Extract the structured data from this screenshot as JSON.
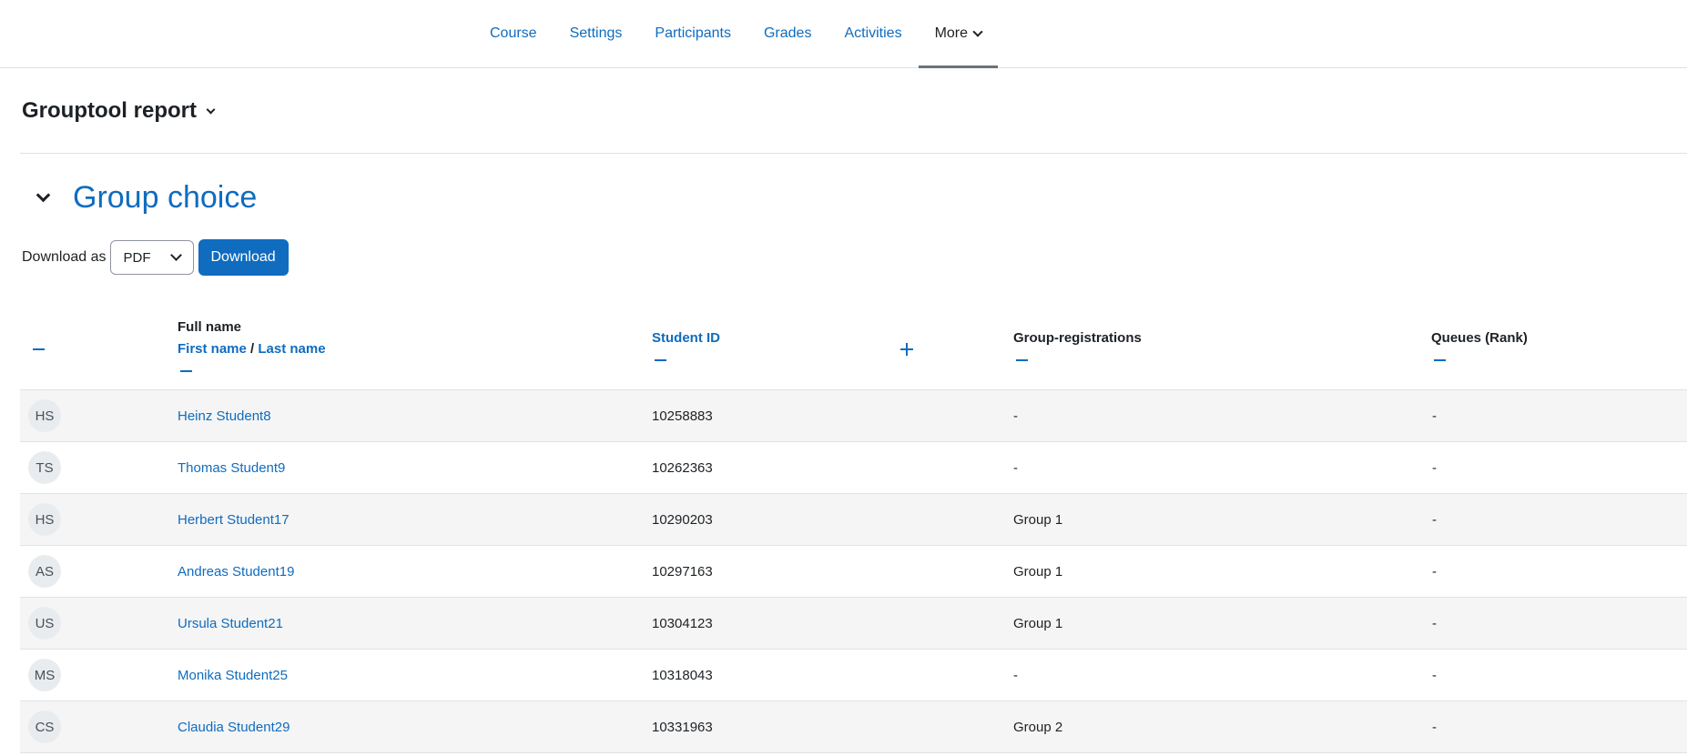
{
  "nav": {
    "items": [
      {
        "label": "Course"
      },
      {
        "label": "Settings"
      },
      {
        "label": "Participants"
      },
      {
        "label": "Grades"
      },
      {
        "label": "Activities"
      },
      {
        "label": "More"
      }
    ],
    "active_index": 5
  },
  "page": {
    "title": "Grouptool report"
  },
  "section": {
    "title": "Group choice"
  },
  "download": {
    "label": "Download as",
    "format_selected": "PDF",
    "button_label": "Download"
  },
  "table": {
    "headers": {
      "full_name": "Full name",
      "first_name": "First name",
      "separator": "/",
      "last_name": "Last name",
      "student_id": "Student ID",
      "group_registrations": "Group-registrations",
      "queues_rank": "Queues (Rank)"
    },
    "rows": [
      {
        "initials": "HS",
        "name": "Heinz Student8",
        "student_id": "10258883",
        "group": "-",
        "queue": "-"
      },
      {
        "initials": "TS",
        "name": "Thomas Student9",
        "student_id": "10262363",
        "group": "-",
        "queue": "-"
      },
      {
        "initials": "HS",
        "name": "Herbert Student17",
        "student_id": "10290203",
        "group": "Group 1",
        "queue": "-"
      },
      {
        "initials": "AS",
        "name": "Andreas Student19",
        "student_id": "10297163",
        "group": "Group 1",
        "queue": "-"
      },
      {
        "initials": "US",
        "name": "Ursula Student21",
        "student_id": "10304123",
        "group": "Group 1",
        "queue": "-"
      },
      {
        "initials": "MS",
        "name": "Monika Student25",
        "student_id": "10318043",
        "group": "-",
        "queue": "-"
      },
      {
        "initials": "CS",
        "name": "Claudia Student29",
        "student_id": "10331963",
        "group": "Group 2",
        "queue": "-"
      }
    ]
  },
  "colors": {
    "link": "#0f6cbf",
    "row_stripe": "#f5f5f5",
    "border": "#dee2e6"
  }
}
